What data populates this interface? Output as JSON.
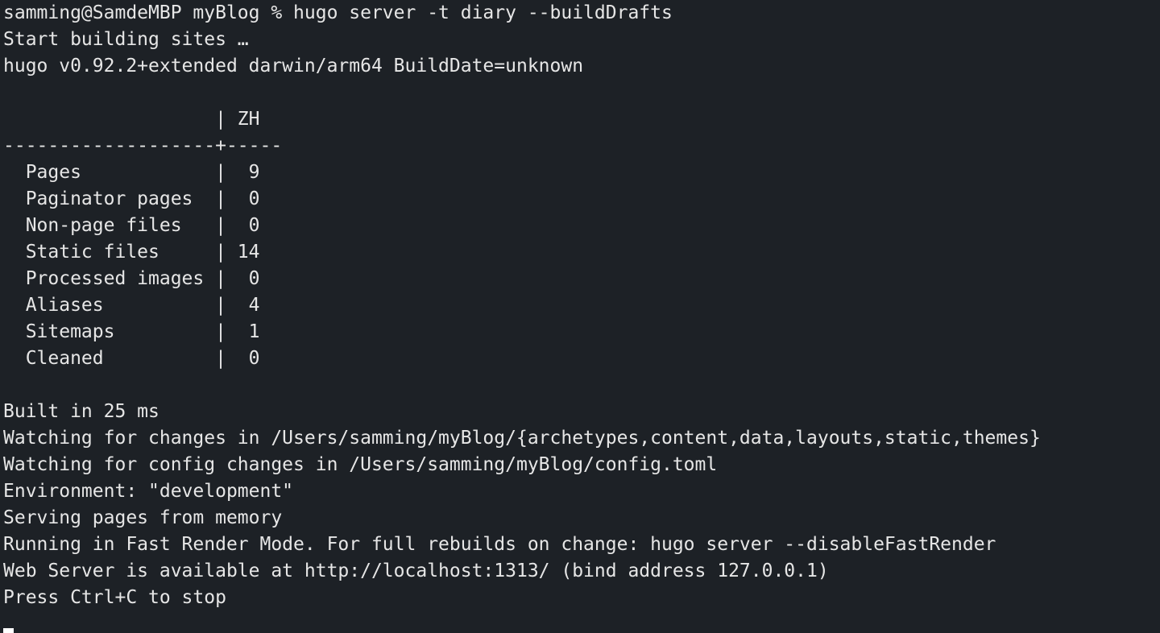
{
  "colors": {
    "background": "#1d2126",
    "text": "#e6e6e6",
    "cursor": "#ffffff"
  },
  "terminal": {
    "lines": [
      "samming@SamdeMBP myBlog % hugo server -t diary --buildDrafts",
      "Start building sites …",
      "hugo v0.92.2+extended darwin/arm64 BuildDate=unknown",
      "",
      "                   | ZH",
      "-------------------+-----",
      "  Pages            |  9",
      "  Paginator pages  |  0",
      "  Non-page files   |  0",
      "  Static files     | 14",
      "  Processed images |  0",
      "  Aliases          |  4",
      "  Sitemaps         |  1",
      "  Cleaned          |  0",
      "",
      "Built in 25 ms",
      "Watching for changes in /Users/samming/myBlog/{archetypes,content,data,layouts,static,themes}",
      "Watching for config changes in /Users/samming/myBlog/config.toml",
      "Environment: \"development\"",
      "Serving pages from memory",
      "Running in Fast Render Mode. For full rebuilds on change: hugo server --disableFastRender",
      "Web Server is available at http://localhost:1313/ (bind address 127.0.0.1)",
      "Press Ctrl+C to stop"
    ]
  }
}
